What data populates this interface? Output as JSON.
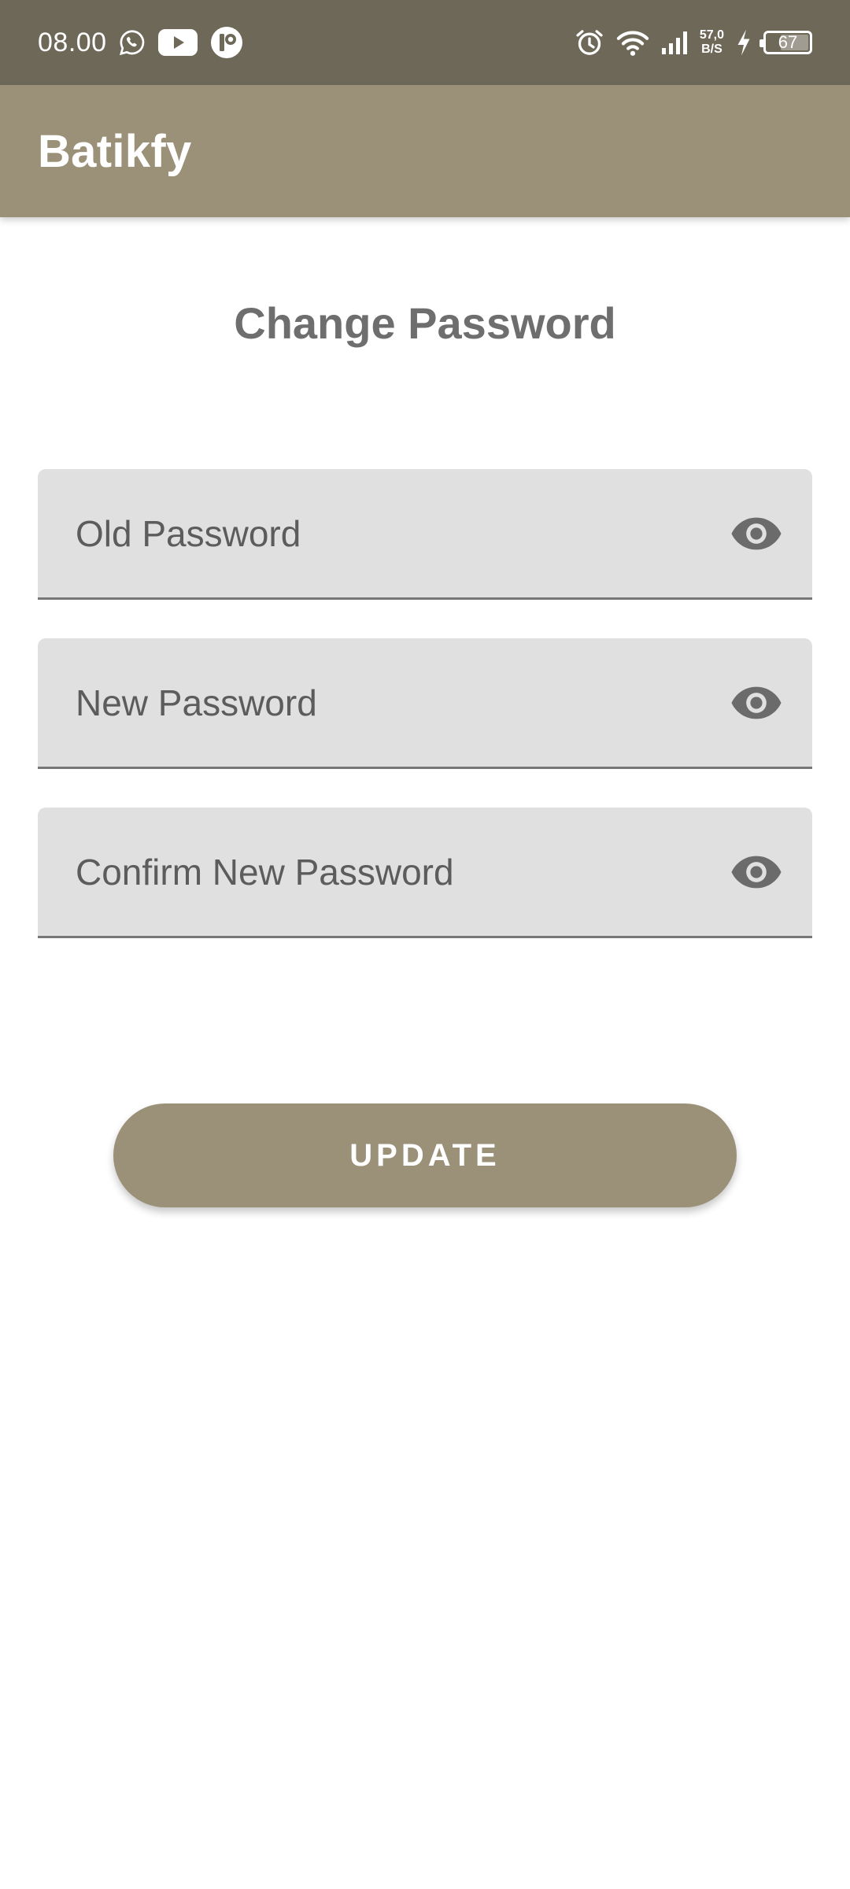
{
  "status_bar": {
    "time": "08.00",
    "net_speed_value": "57,0",
    "net_speed_unit": "B/S",
    "battery": "67",
    "battery_level": 0.67,
    "notification_icons": [
      "whatsapp-icon",
      "youtube-icon",
      "app-notification-icon"
    ],
    "system_icons": [
      "alarm-icon",
      "wifi-icon",
      "signal-icon",
      "charging-icon",
      "battery-icon"
    ]
  },
  "app_bar": {
    "title": "Batikfy"
  },
  "page": {
    "title": "Change Password"
  },
  "form": {
    "old_password": {
      "placeholder": "Old Password",
      "value": ""
    },
    "new_password": {
      "placeholder": "New Password",
      "value": ""
    },
    "confirm_password": {
      "placeholder": "Confirm New Password",
      "value": ""
    },
    "submit_label": "UPDATE"
  },
  "colors": {
    "status_bar": "#6d6857",
    "app_bar": "#9b9078",
    "button": "#9b9078",
    "field_bg": "#e0e0e0",
    "title_text": "#6e6e6e"
  }
}
